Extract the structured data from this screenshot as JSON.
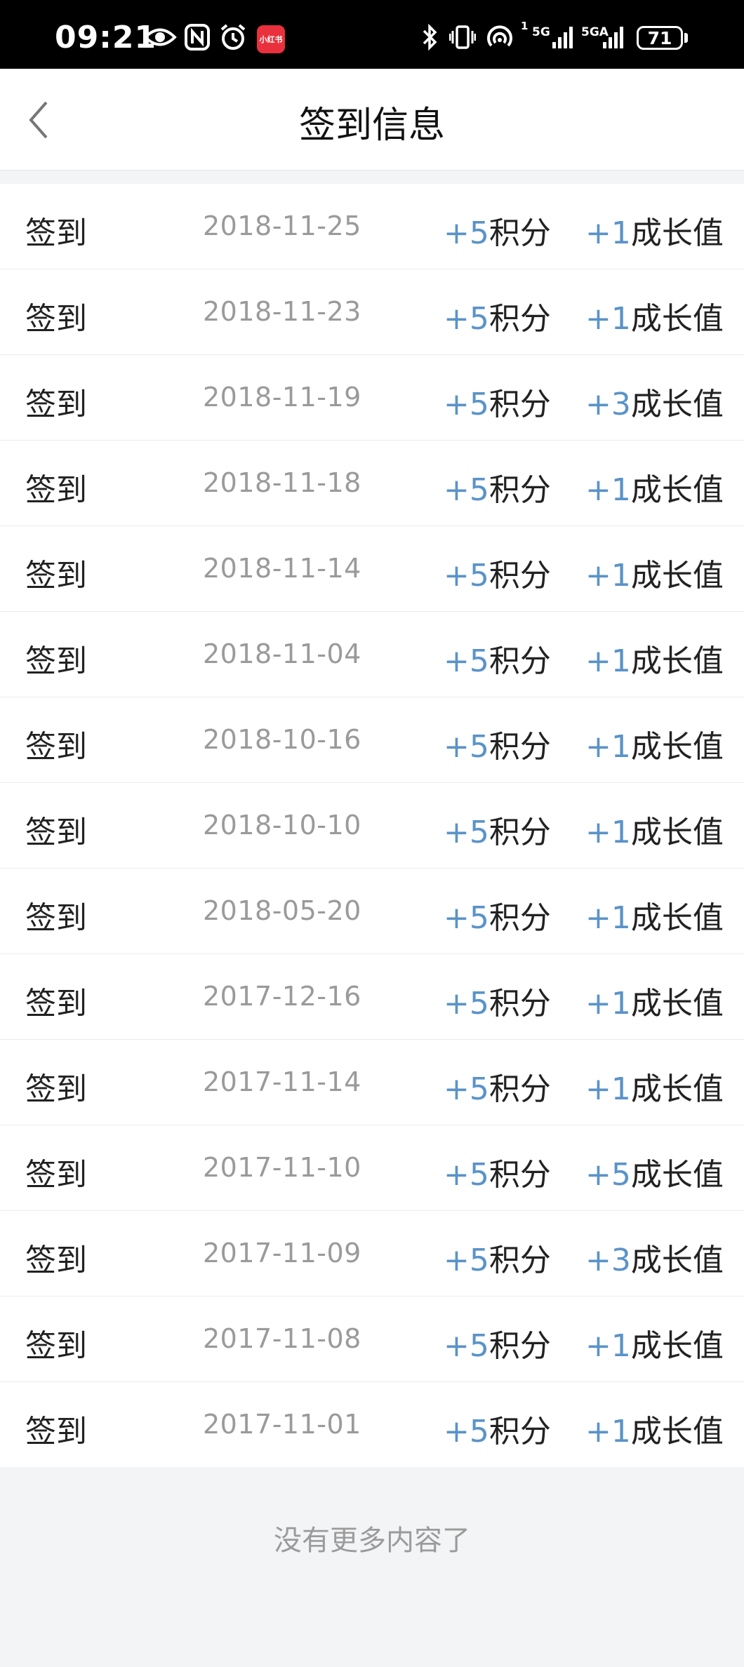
{
  "status_bar": {
    "time": "09:21",
    "app_badge": "小红书",
    "signal_1": "5G",
    "signal_2": "5GA",
    "sim_index": "1",
    "battery": "71",
    "icons": [
      "eye-icon",
      "nfc-icon",
      "alarm-icon",
      "bluetooth-icon",
      "vibrate-icon",
      "hotspot-icon"
    ]
  },
  "header": {
    "title": "签到信息",
    "back_icon": "chevron-left-icon"
  },
  "records": [
    {
      "type": "签到",
      "date": "2018-11-25",
      "points_sign": "+5",
      "points_unit": "积分",
      "growth_sign": "+1",
      "growth_unit": "成长值"
    },
    {
      "type": "签到",
      "date": "2018-11-23",
      "points_sign": "+5",
      "points_unit": "积分",
      "growth_sign": "+1",
      "growth_unit": "成长值"
    },
    {
      "type": "签到",
      "date": "2018-11-19",
      "points_sign": "+5",
      "points_unit": "积分",
      "growth_sign": "+3",
      "growth_unit": "成长值"
    },
    {
      "type": "签到",
      "date": "2018-11-18",
      "points_sign": "+5",
      "points_unit": "积分",
      "growth_sign": "+1",
      "growth_unit": "成长值"
    },
    {
      "type": "签到",
      "date": "2018-11-14",
      "points_sign": "+5",
      "points_unit": "积分",
      "growth_sign": "+1",
      "growth_unit": "成长值"
    },
    {
      "type": "签到",
      "date": "2018-11-04",
      "points_sign": "+5",
      "points_unit": "积分",
      "growth_sign": "+1",
      "growth_unit": "成长值"
    },
    {
      "type": "签到",
      "date": "2018-10-16",
      "points_sign": "+5",
      "points_unit": "积分",
      "growth_sign": "+1",
      "growth_unit": "成长值"
    },
    {
      "type": "签到",
      "date": "2018-10-10",
      "points_sign": "+5",
      "points_unit": "积分",
      "growth_sign": "+1",
      "growth_unit": "成长值"
    },
    {
      "type": "签到",
      "date": "2018-05-20",
      "points_sign": "+5",
      "points_unit": "积分",
      "growth_sign": "+1",
      "growth_unit": "成长值"
    },
    {
      "type": "签到",
      "date": "2017-12-16",
      "points_sign": "+5",
      "points_unit": "积分",
      "growth_sign": "+1",
      "growth_unit": "成长值"
    },
    {
      "type": "签到",
      "date": "2017-11-14",
      "points_sign": "+5",
      "points_unit": "积分",
      "growth_sign": "+1",
      "growth_unit": "成长值"
    },
    {
      "type": "签到",
      "date": "2017-11-10",
      "points_sign": "+5",
      "points_unit": "积分",
      "growth_sign": "+5",
      "growth_unit": "成长值"
    },
    {
      "type": "签到",
      "date": "2017-11-09",
      "points_sign": "+5",
      "points_unit": "积分",
      "growth_sign": "+3",
      "growth_unit": "成长值"
    },
    {
      "type": "签到",
      "date": "2017-11-08",
      "points_sign": "+5",
      "points_unit": "积分",
      "growth_sign": "+1",
      "growth_unit": "成长值"
    },
    {
      "type": "签到",
      "date": "2017-11-01",
      "points_sign": "+5",
      "points_unit": "积分",
      "growth_sign": "+1",
      "growth_unit": "成长值"
    }
  ],
  "footer": {
    "text": "没有更多内容了"
  },
  "colors": {
    "accent": "#5a93c8",
    "date_gray": "#9a9a9a",
    "background": "#f3f4f6"
  }
}
